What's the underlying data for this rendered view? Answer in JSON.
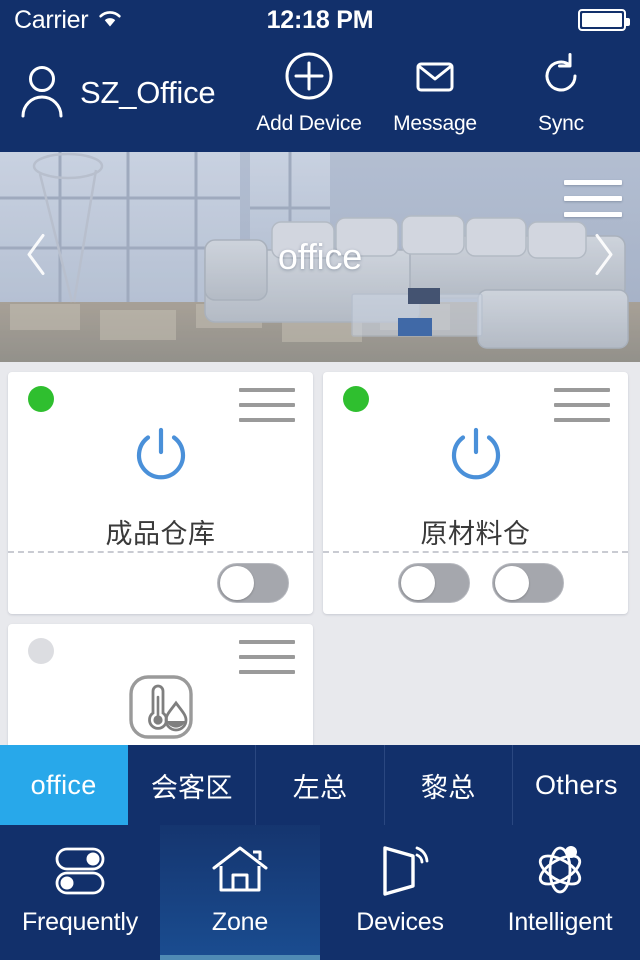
{
  "status_bar": {
    "carrier": "Carrier",
    "wifi_icon": "wifi-icon",
    "time": "12:18 PM",
    "battery_icon": "battery-full-icon"
  },
  "header": {
    "user_icon": "user-avatar-icon",
    "account_name": "SZ_Office",
    "actions": [
      {
        "label": "Add Device",
        "icon": "plus-circle-icon"
      },
      {
        "label": "Message",
        "icon": "envelope-icon"
      },
      {
        "label": "Sync",
        "icon": "refresh-icon"
      }
    ]
  },
  "hero": {
    "title": "office",
    "prev_icon": "chevron-left-icon",
    "next_icon": "chevron-right-icon",
    "menu_icon": "hamburger-menu-icon"
  },
  "colors": {
    "header_blue": "#12306b",
    "accent_blue": "#28a8ea",
    "power_blue": "#4a90d9",
    "status_online": "#2fbf2f",
    "status_offline": "#dcdde1",
    "page_bg": "#e8e9ed",
    "toggle_off": "#a5a7ad"
  },
  "devices": [
    {
      "name": "成品仓库",
      "status": "online",
      "icon": "power-icon",
      "menu_icon": "hamburger-menu-icon",
      "switch_count": 1,
      "switches": [
        {
          "state": "off"
        }
      ]
    },
    {
      "name": "原材料仓",
      "status": "online",
      "icon": "power-icon",
      "menu_icon": "hamburger-menu-icon",
      "switch_count": 2,
      "switches": [
        {
          "state": "off"
        },
        {
          "state": "off"
        }
      ]
    },
    {
      "name": "",
      "status": "offline",
      "icon": "temperature-humidity-sensor-icon",
      "menu_icon": "hamburger-menu-icon",
      "switch_count": 0,
      "switches": []
    }
  ],
  "zone_tabs": [
    {
      "label": "office",
      "active": true
    },
    {
      "label": "会客区",
      "active": false
    },
    {
      "label": "左总",
      "active": false
    },
    {
      "label": "黎总",
      "active": false
    },
    {
      "label": "Others",
      "active": false
    }
  ],
  "bottom_nav": [
    {
      "label": "Frequently",
      "icon": "toggles-icon",
      "active": false
    },
    {
      "label": "Zone",
      "icon": "home-icon",
      "active": true
    },
    {
      "label": "Devices",
      "icon": "device-wifi-icon",
      "active": false
    },
    {
      "label": "Intelligent",
      "icon": "atom-icon",
      "active": false
    }
  ]
}
